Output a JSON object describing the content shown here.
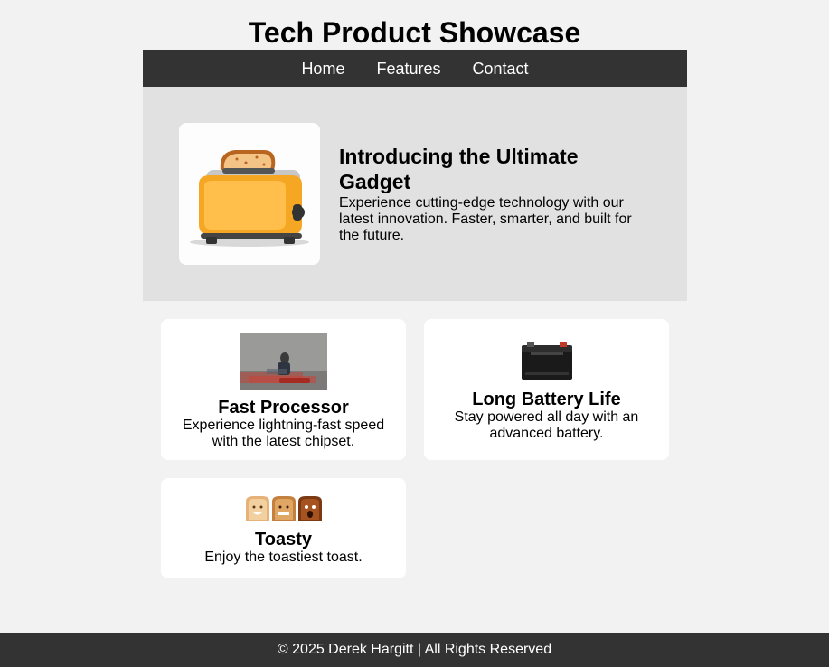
{
  "header": {
    "title": "Tech Product Showcase"
  },
  "nav": {
    "items": [
      "Home",
      "Features",
      "Contact"
    ]
  },
  "hero": {
    "image_icon": "toaster-icon",
    "title": "Introducing the Ultimate Gadget",
    "description": "Experience cutting-edge technology with our latest innovation. Faster, smarter, and built for the future."
  },
  "features": [
    {
      "image": "speeding-person-photo",
      "title": "Fast Processor",
      "description": "Experience lightning-fast speed with the latest chipset."
    },
    {
      "image": "car-battery-photo",
      "title": "Long Battery Life",
      "description": "Stay powered all day with an advanced battery."
    },
    {
      "image": "toast-faces-photo",
      "title": "Toasty",
      "description": "Enjoy the toastiest toast."
    }
  ],
  "footer": {
    "text": "© 2025 Derek Hargitt | All Rights Reserved"
  },
  "colors": {
    "nav_bg": "#333333",
    "hero_bg": "#e1e1e1",
    "page_bg": "#f2f2f2",
    "card_bg": "#ffffff"
  }
}
